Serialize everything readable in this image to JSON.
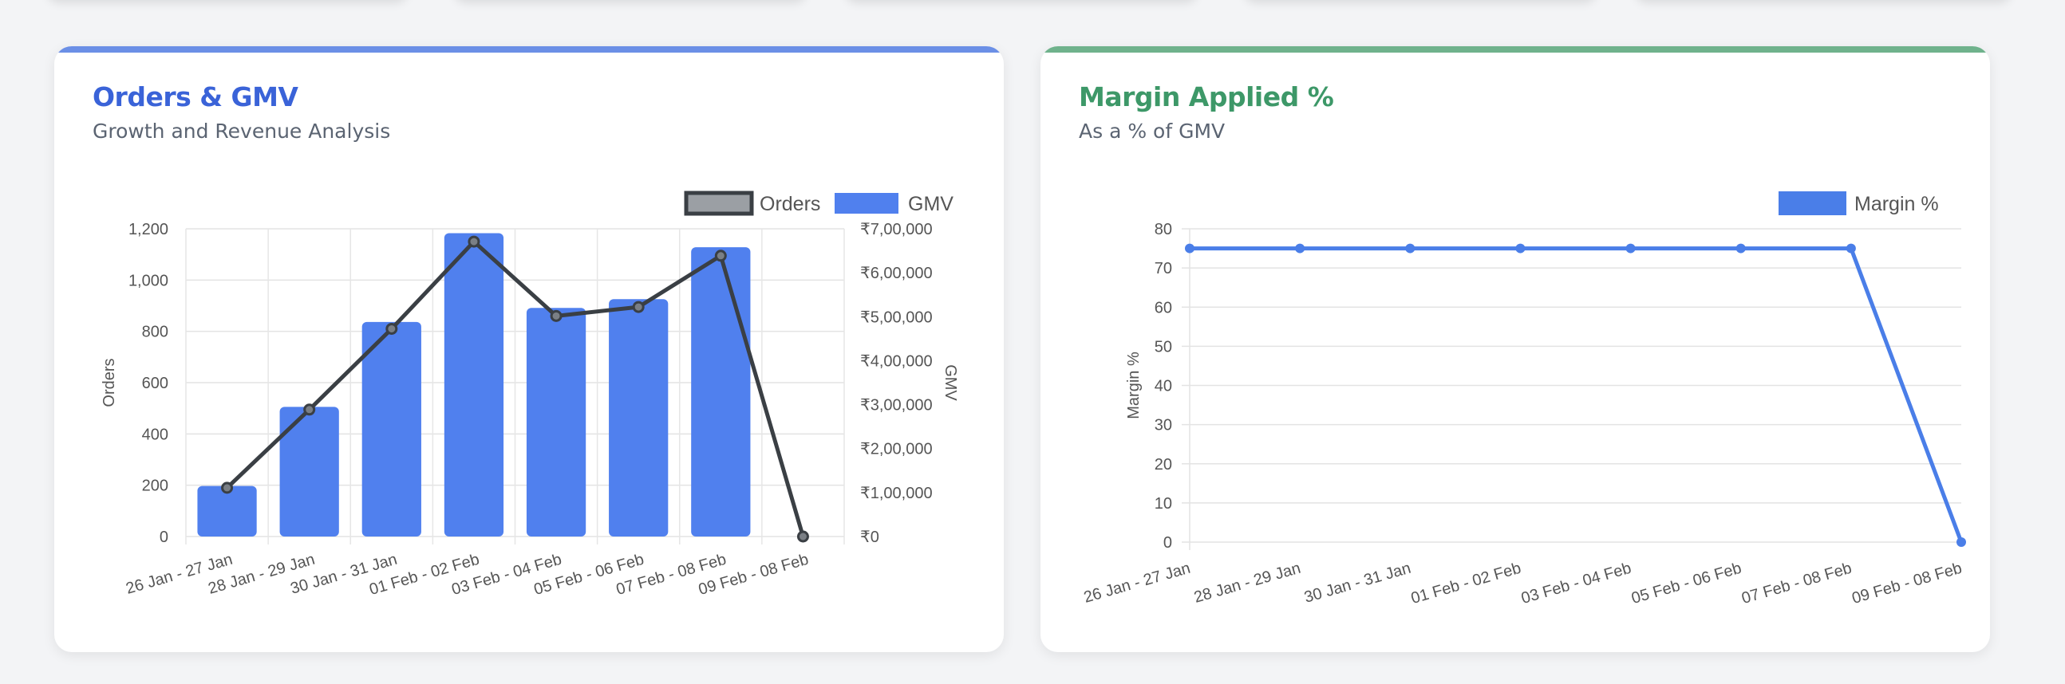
{
  "colors": {
    "blue_accent": "#6b8fe6",
    "green_accent": "#6fb28c",
    "orders_title": "#3a63d8",
    "margin_title": "#3d9868",
    "bar_fill": "#5080ee",
    "orders_line": "#3a3f44",
    "margin_line": "#4a7ee8"
  },
  "orders_card": {
    "title": "Orders & GMV",
    "subtitle": "Growth and Revenue Analysis"
  },
  "margin_card": {
    "title": "Margin Applied %",
    "subtitle": "As a % of GMV"
  },
  "chart_data": [
    {
      "type": "bar",
      "categories": [
        "26 Jan - 27 Jan",
        "28 Jan - 29 Jan",
        "30 Jan - 31 Jan",
        "01 Feb - 02 Feb",
        "03 Feb - 04 Feb",
        "05 Feb - 06 Feb",
        "07 Feb - 08 Feb",
        "09 Feb - 08 Feb"
      ],
      "series": [
        {
          "name": "Orders",
          "type": "line",
          "axis": "left",
          "values": [
            190,
            495,
            810,
            1150,
            860,
            895,
            1095,
            0
          ]
        },
        {
          "name": "GMV",
          "type": "bar",
          "axis": "right",
          "values": [
            115000,
            295000,
            488000,
            690000,
            520000,
            540000,
            658000,
            0
          ]
        }
      ],
      "ylabel": "Orders",
      "y2label": "GMV",
      "ylim": [
        0,
        1200
      ],
      "y2lim": [
        0,
        700000
      ],
      "yticks": [
        "0",
        "200",
        "400",
        "600",
        "800",
        "1,000",
        "1,200"
      ],
      "y2ticks": [
        "₹0",
        "₹1,00,000",
        "₹2,00,000",
        "₹3,00,000",
        "₹4,00,000",
        "₹5,00,000",
        "₹6,00,000",
        "₹7,00,000"
      ],
      "legend": [
        {
          "label": "Orders",
          "kind": "line"
        },
        {
          "label": "GMV",
          "kind": "bar"
        }
      ],
      "legend_position": "top-right",
      "grid": true
    },
    {
      "type": "line",
      "categories": [
        "26 Jan - 27 Jan",
        "28 Jan - 29 Jan",
        "30 Jan - 31 Jan",
        "01 Feb - 02 Feb",
        "03 Feb - 04 Feb",
        "05 Feb - 06 Feb",
        "07 Feb - 08 Feb",
        "09 Feb - 08 Feb"
      ],
      "series": [
        {
          "name": "Margin %",
          "values": [
            75,
            75,
            75,
            75,
            75,
            75,
            75,
            0
          ]
        }
      ],
      "ylabel": "Margin %",
      "ylim": [
        0,
        80
      ],
      "yticks": [
        "0",
        "10",
        "20",
        "30",
        "40",
        "50",
        "60",
        "70",
        "80"
      ],
      "legend": [
        {
          "label": "Margin %",
          "kind": "bar"
        }
      ],
      "legend_position": "top-right",
      "grid": true
    }
  ]
}
